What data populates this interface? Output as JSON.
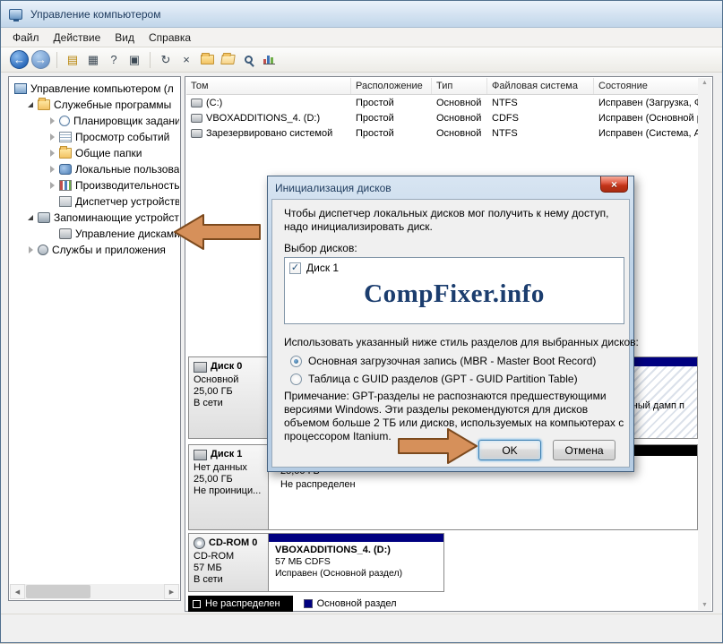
{
  "window": {
    "title": "Управление компьютером"
  },
  "menu": {
    "file": "Файл",
    "action": "Действие",
    "view": "Вид",
    "help": "Справка"
  },
  "toolbar": {
    "icons": [
      "back-icon",
      "forward-icon",
      "export-list-icon",
      "show-tree-icon",
      "help-icon",
      "properties-icon",
      "refresh-icon",
      "delete-icon",
      "folder-icon",
      "open-folder-icon",
      "search-icon",
      "chart-icon"
    ]
  },
  "tree": {
    "root": "Управление компьютером (л",
    "items": [
      {
        "label": "Служебные программы",
        "state": "expanded"
      },
      {
        "label": "Планировщик заданий",
        "state": "collapsed"
      },
      {
        "label": "Просмотр событий",
        "state": "collapsed"
      },
      {
        "label": "Общие папки",
        "state": "collapsed"
      },
      {
        "label": "Локальные пользовате",
        "state": "collapsed"
      },
      {
        "label": "Производительность",
        "state": "collapsed"
      },
      {
        "label": "Диспетчер устройств",
        "state": "leaf"
      },
      {
        "label": "Запоминающие устройст",
        "state": "expanded"
      },
      {
        "label": "Управление дисками",
        "state": "leaf"
      },
      {
        "label": "Службы и приложения",
        "state": "collapsed"
      }
    ]
  },
  "volumes": {
    "columns": [
      "Том",
      "Расположение",
      "Тип",
      "Файловая система",
      "Состояние"
    ],
    "rows": [
      [
        "(C:)",
        "Простой",
        "Основной",
        "NTFS",
        "Исправен (Загрузка, Фай"
      ],
      [
        "VBOXADDITIONS_4. (D:)",
        "Простой",
        "Основной",
        "CDFS",
        "Исправен (Основной раз"
      ],
      [
        "Зарезервировано системой",
        "Простой",
        "Основной",
        "NTFS",
        "Исправен (Система, Акти"
      ]
    ]
  },
  "disks": {
    "disk0": {
      "name": "Диск 0",
      "lines": [
        "Основной",
        "25,00 ГБ",
        "В сети"
      ],
      "fragment": "ный дамп п"
    },
    "disk1": {
      "name": "Диск 1",
      "lines": [
        "Нет данных",
        "25,00 ГБ",
        "Не проиници..."
      ],
      "bar1": "25,00 ГБ",
      "bar2": "Не распределен"
    },
    "cdrom": {
      "name": "CD-ROM 0",
      "lines": [
        "CD-ROM",
        "57 МБ",
        "В сети"
      ],
      "bar_title": "VBOXADDITIONS_4. (D:)",
      "bar1": "57 МБ CDFS",
      "bar2": "Исправен (Основной раздел)"
    }
  },
  "legend": {
    "unallocated": "Не распределен",
    "primary": "Основной раздел"
  },
  "dialog": {
    "title": "Инициализация дисков",
    "intro": "Чтобы диспетчер локальных дисков мог получить к нему доступ, надо инициализировать диск.",
    "select_label": "Выбор дисков:",
    "disk_item": "Диск 1",
    "checkbox_glyph": "✓",
    "watermark": "CompFixer.info",
    "style_label": "Использовать указанный ниже стиль разделов для выбранных дисков:",
    "radio_mbr": "Основная загрузочная запись (MBR - Master Boot Record)",
    "radio_gpt": "Таблица с GUID разделов (GPT - GUID Partition Table)",
    "note": "Примечание: GPT-разделы не распознаются предшествующими версиями Windows. Эти разделы рекомендуются для дисков объемом больше 2 ТБ или дисков, используемых на компьютерах с процессором Itanium.",
    "ok": "OK",
    "cancel": "Отмена",
    "close_glyph": "×"
  },
  "colors": {
    "primary_partition": "#000080",
    "unallocated": "#000000",
    "arrow_fill": "#d6905a",
    "arrow_stroke": "#7c4a1e"
  }
}
